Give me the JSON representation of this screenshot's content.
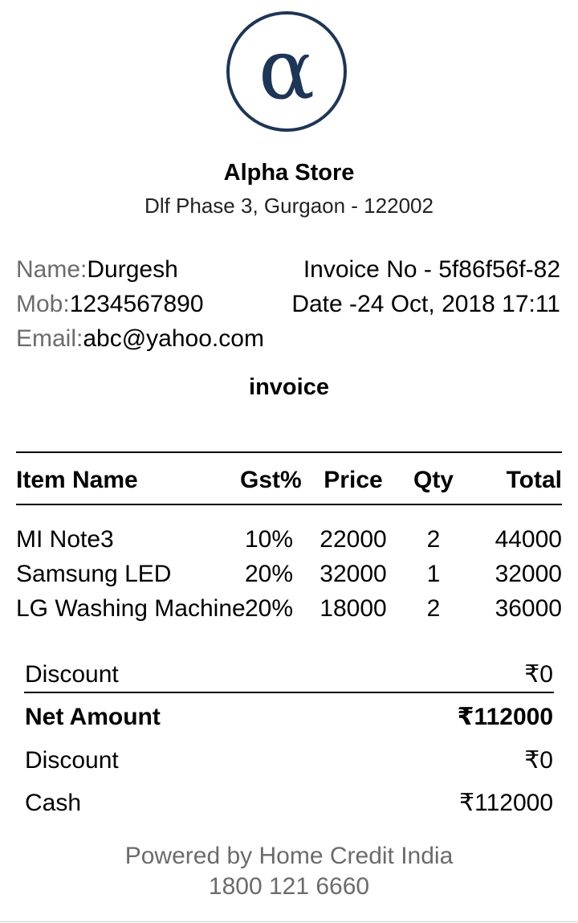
{
  "store": {
    "logo_glyph": "α",
    "name": "Alpha Store",
    "address": "Dlf Phase 3, Gurgaon - 122002",
    "brand_color": "#1d3557"
  },
  "customer": {
    "name_label": "Name:",
    "name": "Durgesh",
    "mob_label": "Mob:",
    "mob": "1234567890",
    "email_label": "Email:",
    "email": "abc@yahoo.com"
  },
  "invoice_meta": {
    "invoice_no": "Invoice No - 5f86f56f-82",
    "date": "Date -24 Oct, 2018 17:11"
  },
  "title": "invoice",
  "table": {
    "headers": {
      "item": "Item Name",
      "gst": "Gst%",
      "price": "Price",
      "qty": "Qty",
      "total": "Total"
    },
    "rows": [
      {
        "item": "MI Note3",
        "gst": "10%",
        "price": "22000",
        "qty": "2",
        "total": "44000"
      },
      {
        "item": "Samsung LED",
        "gst": "20%",
        "price": "32000",
        "qty": "1",
        "total": "32000"
      },
      {
        "item": "LG Washing Machine",
        "gst": "20%",
        "price": "18000",
        "qty": "2",
        "total": "36000"
      }
    ]
  },
  "summary": {
    "discount_label": "Discount",
    "discount_value": "₹0",
    "net_label": "Net Amount",
    "net_value": "₹112000",
    "discount2_label": "Discount",
    "discount2_value": "₹0",
    "cash_label": "Cash",
    "cash_value": "₹112000"
  },
  "footer": {
    "powered_by": "Powered by Home Credit India",
    "phone": "1800 121 6660"
  }
}
